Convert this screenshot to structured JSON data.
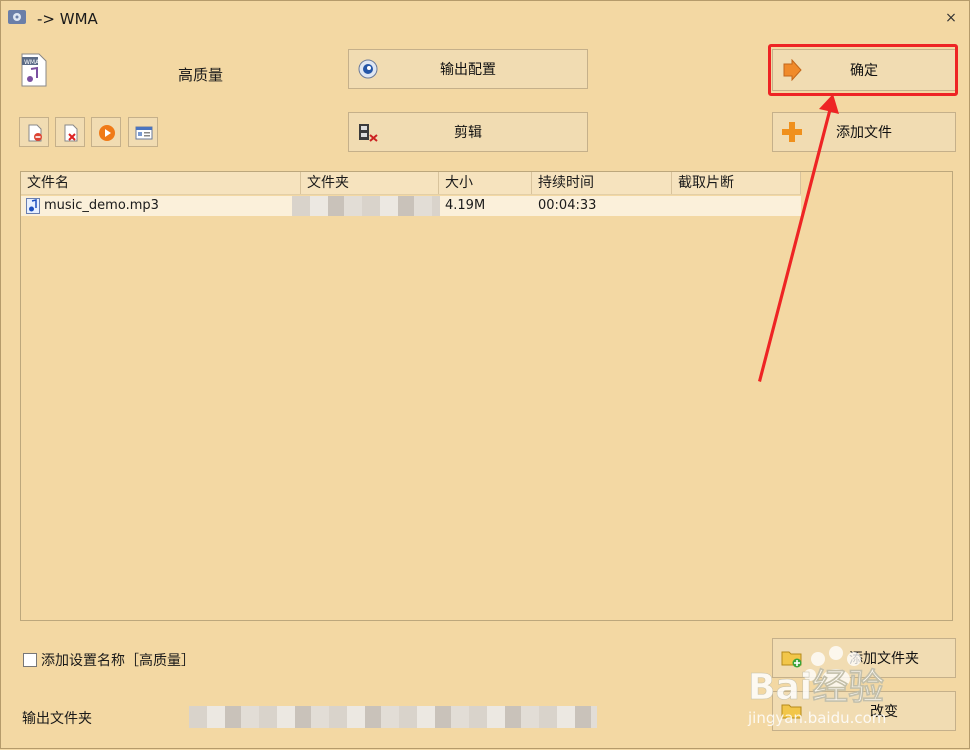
{
  "window": {
    "title": "-> WMA",
    "close_glyph": "×"
  },
  "preset": {
    "label": "高质量",
    "icon": "wma-file-icon"
  },
  "buttons": {
    "output_config": "输出配置",
    "edit": "剪辑",
    "confirm": "确定",
    "add_file": "添加文件",
    "add_folder": "添加文件夹",
    "change": "改变"
  },
  "toolbar": [
    "remove-file-icon",
    "delete-file-icon",
    "play-icon",
    "info-icon"
  ],
  "table": {
    "columns": [
      "文件名",
      "文件夹",
      "大小",
      "持续时间",
      "截取片断"
    ],
    "rows": [
      {
        "name": "music_demo.mp3",
        "size": "4.19M",
        "duration": "00:04:33"
      }
    ]
  },
  "options": {
    "add_setting_name": "添加设置名称［高质量］"
  },
  "output": {
    "label": "输出文件夹"
  },
  "watermark": {
    "brand": "Bai经验",
    "url": "jingyan.baidu.com"
  },
  "colors": {
    "background": "#F3D8A3",
    "annotation": "#EE2424"
  }
}
